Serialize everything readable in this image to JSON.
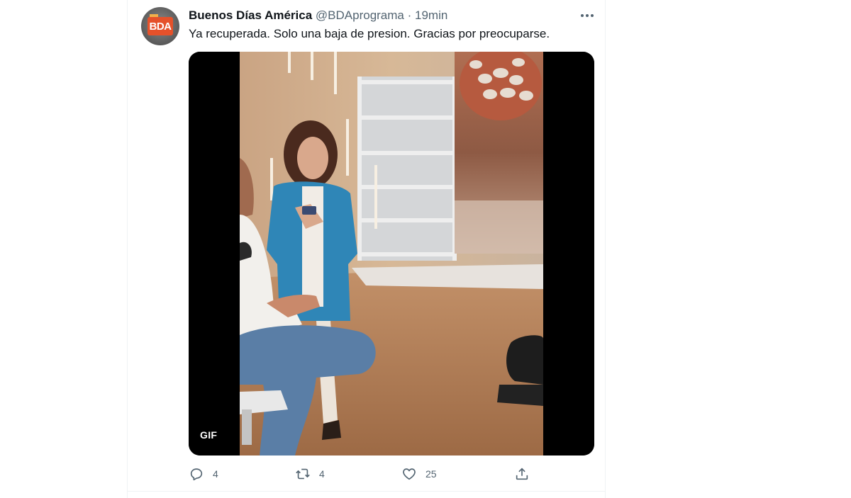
{
  "tweet": {
    "author_name": "Buenos Días América",
    "handle": "@BDAprograma",
    "separator": "·",
    "time": "19min",
    "avatar_text": "BDA",
    "text": "Ya recuperada. Solo una baja de presion. Gracias por preocuparse.",
    "media_badge": "GIF"
  },
  "actions": {
    "reply": {
      "icon": "reply-icon",
      "count": "4"
    },
    "retweet": {
      "icon": "retweet-icon",
      "count": "4"
    },
    "like": {
      "icon": "heart-icon",
      "count": "25"
    },
    "share": {
      "icon": "share-icon"
    }
  },
  "colors": {
    "text": "#0f1419",
    "secondary": "#536471",
    "divider": "#eff3f4",
    "avatar_badge": "#e5512a"
  }
}
